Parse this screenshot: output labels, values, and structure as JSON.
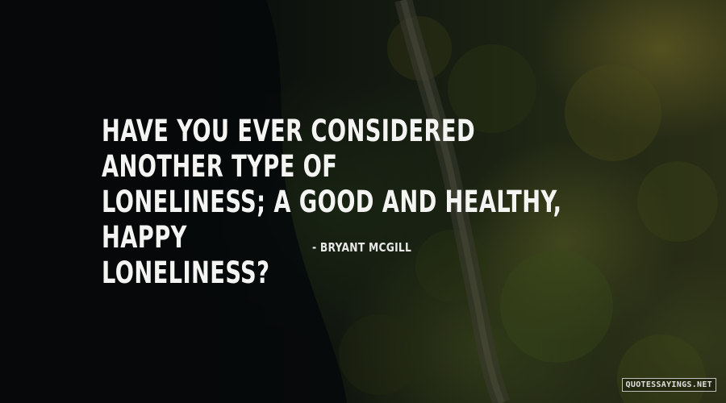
{
  "quote": {
    "lines": [
      "HAVE YOU EVER CONSIDERED ANOTHER TYPE OF",
      "LONELINESS; A GOOD AND HEALTHY, HAPPY",
      "LONELINESS?"
    ]
  },
  "author": {
    "label": "- BRYANT MCGILL"
  },
  "watermark": {
    "text": "QUOTESSAYINGS.NET"
  },
  "colors": {
    "text": "#f4f4f2",
    "background": "#0b0e0a"
  }
}
